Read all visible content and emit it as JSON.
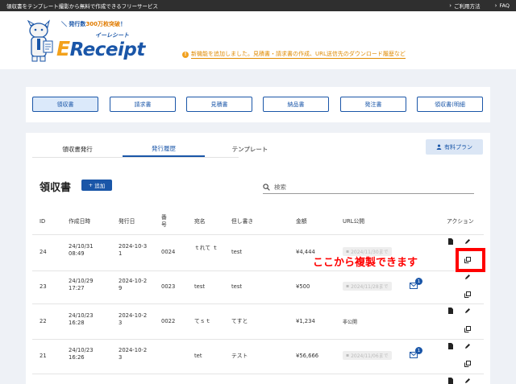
{
  "topbar": {
    "tagline": "領収書をテンプレート撮影から無料で作成できるフリーサービス",
    "links": [
      "ご利用方法",
      "FAQ"
    ]
  },
  "header": {
    "catch_prefix": "＼ 発行数",
    "catch_highlight": "300万枚突破",
    "catch_suffix": "！",
    "logo_kana": "イーレシート",
    "logo_e": "E",
    "logo_rest": "Receipt",
    "notice": "新機能を追加しました。見積書・請求書の作成、URL送信先のダウンロード履歴など"
  },
  "doc_tabs": [
    "領収書",
    "請求書",
    "見積書",
    "納品書",
    "発注書",
    "領収書(明細"
  ],
  "sub_tabs": [
    "領収書発行",
    "発行履歴",
    "テンプレート"
  ],
  "paid_plan_label": "有料プラン",
  "doc_title": "領収書",
  "add_label": "追加",
  "search_placeholder": "検索",
  "columns": {
    "id": "ID",
    "created": "作成日時",
    "issued": "発行日",
    "number": "番号",
    "addressee": "宛名",
    "note": "但し書き",
    "amount": "金額",
    "url": "URL公開",
    "action": "アクション"
  },
  "rows": [
    {
      "id": "24",
      "created": "24/10/31 08:49",
      "issued": "2024-10-31",
      "number": "0024",
      "addressee": "ｔれて ｔ",
      "note": "test",
      "amount": "¥4,444",
      "url_pill": "2024/11/30まで",
      "mail_count": ""
    },
    {
      "id": "23",
      "created": "24/10/29 17:27",
      "issued": "2024-10-29",
      "number": "0023",
      "addressee": "test",
      "note": "test",
      "amount": "¥500",
      "url_pill": "2024/11/28まで",
      "mail_count": "1"
    },
    {
      "id": "22",
      "created": "24/10/23 16:28",
      "issued": "2024-10-23",
      "number": "0022",
      "addressee": "てｓｔ",
      "note": "てすと",
      "amount": "¥1,234",
      "url_text": "非公開"
    },
    {
      "id": "21",
      "created": "24/10/23 16:26",
      "issued": "2024-10-23",
      "number": "",
      "addressee": "tet",
      "note": "テスト",
      "amount": "¥56,666",
      "url_pill": "2024/11/06まで",
      "mail_count": "1"
    }
  ],
  "annotation": "ここから複製できます",
  "colors": {
    "brand": "#1a56a8",
    "accent": "#f3a11b",
    "highlight": "#ff0000"
  }
}
